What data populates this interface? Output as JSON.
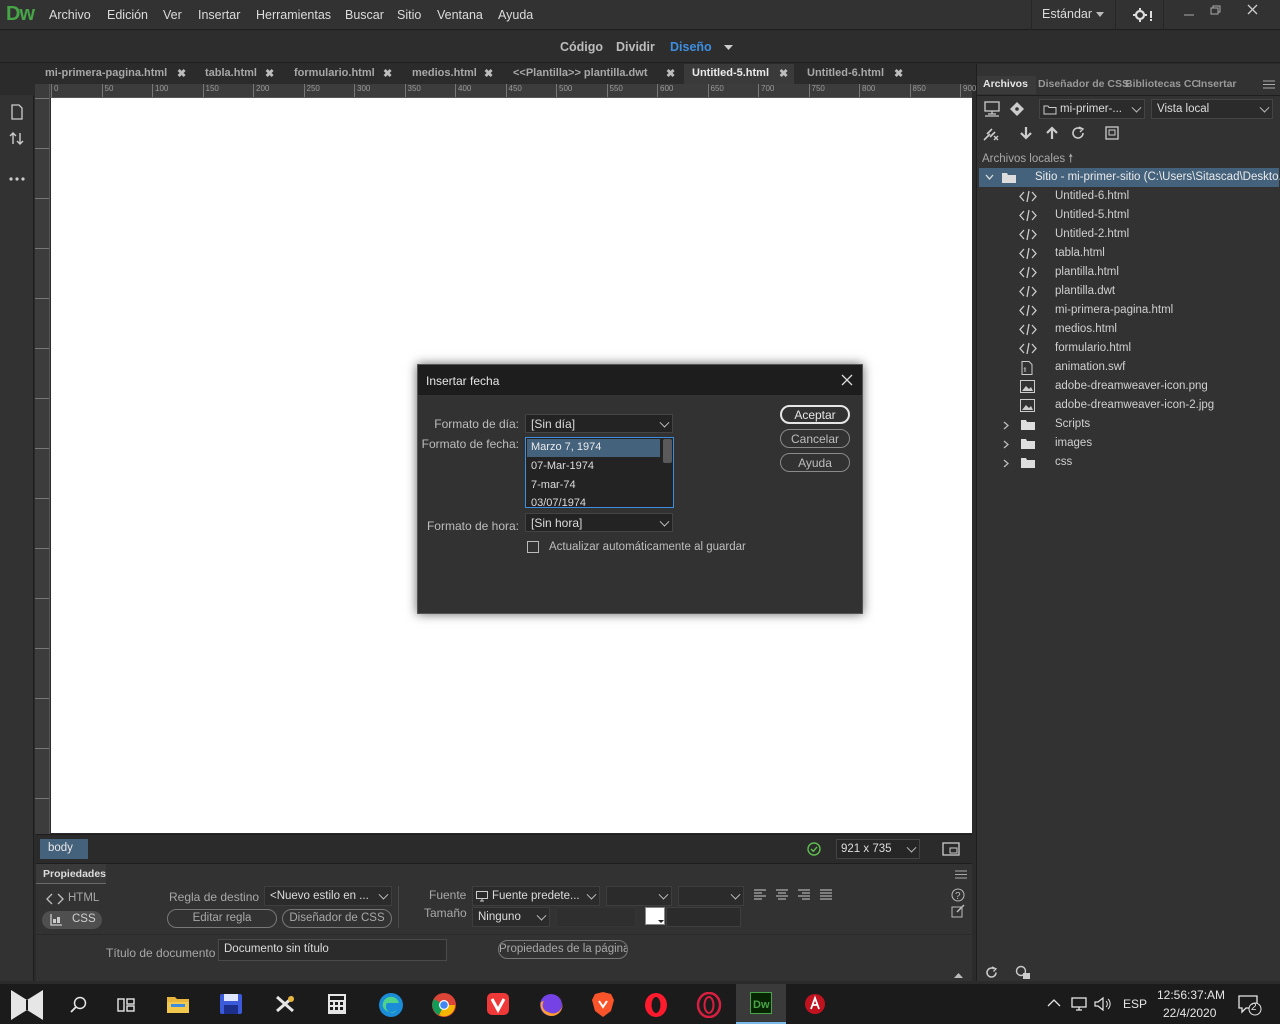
{
  "app": {
    "logo": "Dw"
  },
  "menu": [
    "Archivo",
    "Edición",
    "Ver",
    "Insertar",
    "Herramientas",
    "Buscar",
    "Sitio",
    "Ventana",
    "Ayuda"
  ],
  "workspace": "Estándar",
  "views": {
    "code": "Código",
    "split": "Dividir",
    "design": "Diseño"
  },
  "tabs": [
    "mi-primera-pagina.html",
    "tabla.html",
    "formulario.html",
    "medios.html",
    "<<Plantilla>> plantilla.dwt",
    "Untitled-5.html",
    "Untitled-6.html"
  ],
  "active_tab": "Untitled-5.html",
  "ruler": [
    "0",
    "50",
    "100",
    "150",
    "200",
    "250",
    "300",
    "350",
    "400",
    "450",
    "500",
    "550",
    "600",
    "650",
    "700",
    "750",
    "800",
    "850",
    "900"
  ],
  "status": {
    "tag": "body",
    "size": "921 x 735"
  },
  "properties": {
    "title": "Propiedades",
    "html": "HTML",
    "css": "CSS",
    "target_rule_label": "Regla de destino",
    "target_rule": "<Nuevo estilo en ...",
    "edit_rule": "Editar regla",
    "css_designer": "Diseñador de CSS",
    "font_label": "Fuente",
    "font": "Fuente predete...",
    "size_label": "Tamaño",
    "size": "Ninguno",
    "doc_title_label": "Título de documento",
    "doc_title": "Documento sin título",
    "page_props": "Propiedades de la página"
  },
  "panel": {
    "tabs": [
      "Archivos",
      "Diseñador de CSS",
      "Bibliotecas CC",
      "Insertar"
    ],
    "site": "mi-primer-...",
    "view": "Vista local",
    "local_label": "Archivos locales",
    "root": "Sitio - mi-primer-sitio (C:\\Users\\Sitascad\\Deskto...",
    "files": [
      {
        "name": "Untitled-6.html",
        "type": "code"
      },
      {
        "name": "Untitled-5.html",
        "type": "code"
      },
      {
        "name": "Untitled-2.html",
        "type": "code"
      },
      {
        "name": "tabla.html",
        "type": "code"
      },
      {
        "name": "plantilla.html",
        "type": "code"
      },
      {
        "name": "plantilla.dwt",
        "type": "code"
      },
      {
        "name": "mi-primera-pagina.html",
        "type": "code"
      },
      {
        "name": "medios.html",
        "type": "code"
      },
      {
        "name": "formulario.html",
        "type": "code"
      },
      {
        "name": "animation.swf",
        "type": "swf"
      },
      {
        "name": "adobe-dreamweaver-icon.png",
        "type": "image"
      },
      {
        "name": "adobe-dreamweaver-icon-2.jpg",
        "type": "image"
      },
      {
        "name": "Scripts",
        "type": "folder"
      },
      {
        "name": "images",
        "type": "folder"
      },
      {
        "name": "css",
        "type": "folder"
      }
    ]
  },
  "dialog": {
    "title": "Insertar fecha",
    "day_label": "Formato de día:",
    "day_value": "[Sin día]",
    "date_label": "Formato de fecha:",
    "date_options": [
      "Marzo 7, 1974",
      "07-Mar-1974",
      "7-mar-74",
      "03/07/1974"
    ],
    "selected_date": "Marzo 7, 1974",
    "time_label": "Formato de hora:",
    "time_value": "[Sin hora]",
    "auto_update": "Actualizar automáticamente al guardar",
    "auto_update_checked": false,
    "ok": "Aceptar",
    "cancel": "Cancelar",
    "help": "Ayuda"
  },
  "taskbar": {
    "lang": "ESP",
    "time": "12:56:37:AM",
    "date": "22/4/2020",
    "notifications": "2"
  },
  "colors": {
    "accent": "#3d8ee0",
    "dw_green": "#47a447",
    "status_ok": "#5fbf4f"
  }
}
